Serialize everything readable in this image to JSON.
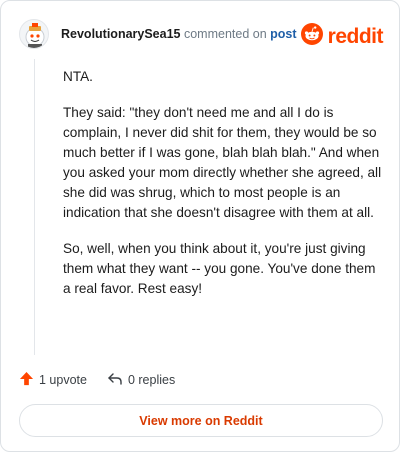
{
  "comment": {
    "username": "RevolutionarySea15",
    "action_text": "commented on",
    "post_link": "post",
    "paragraphs": [
      "NTA.",
      "They said: \"they don't need me and all I do is complain, I never did shit for them, they would be so much better if I was gone, blah blah blah.\" And when you asked your mom directly whether she agreed, all she did was shrug, which to most people is an indication that she doesn't disagree with them at all.",
      "So, well, when you think about it, you're just giving them what they want -- you gone. You've done them a real favor. Rest easy!"
    ]
  },
  "brand": {
    "name": "reddit",
    "color": "#ff4500"
  },
  "actions": {
    "upvote_label": "1 upvote",
    "reply_label": "0 replies"
  },
  "footer": {
    "view_more_label": "View more on Reddit"
  },
  "icons": {
    "avatar": "snoo-avatar-icon",
    "brand_logo": "reddit-logo-icon",
    "upvote": "upvote-arrow-icon",
    "reply": "reply-arrow-icon"
  }
}
